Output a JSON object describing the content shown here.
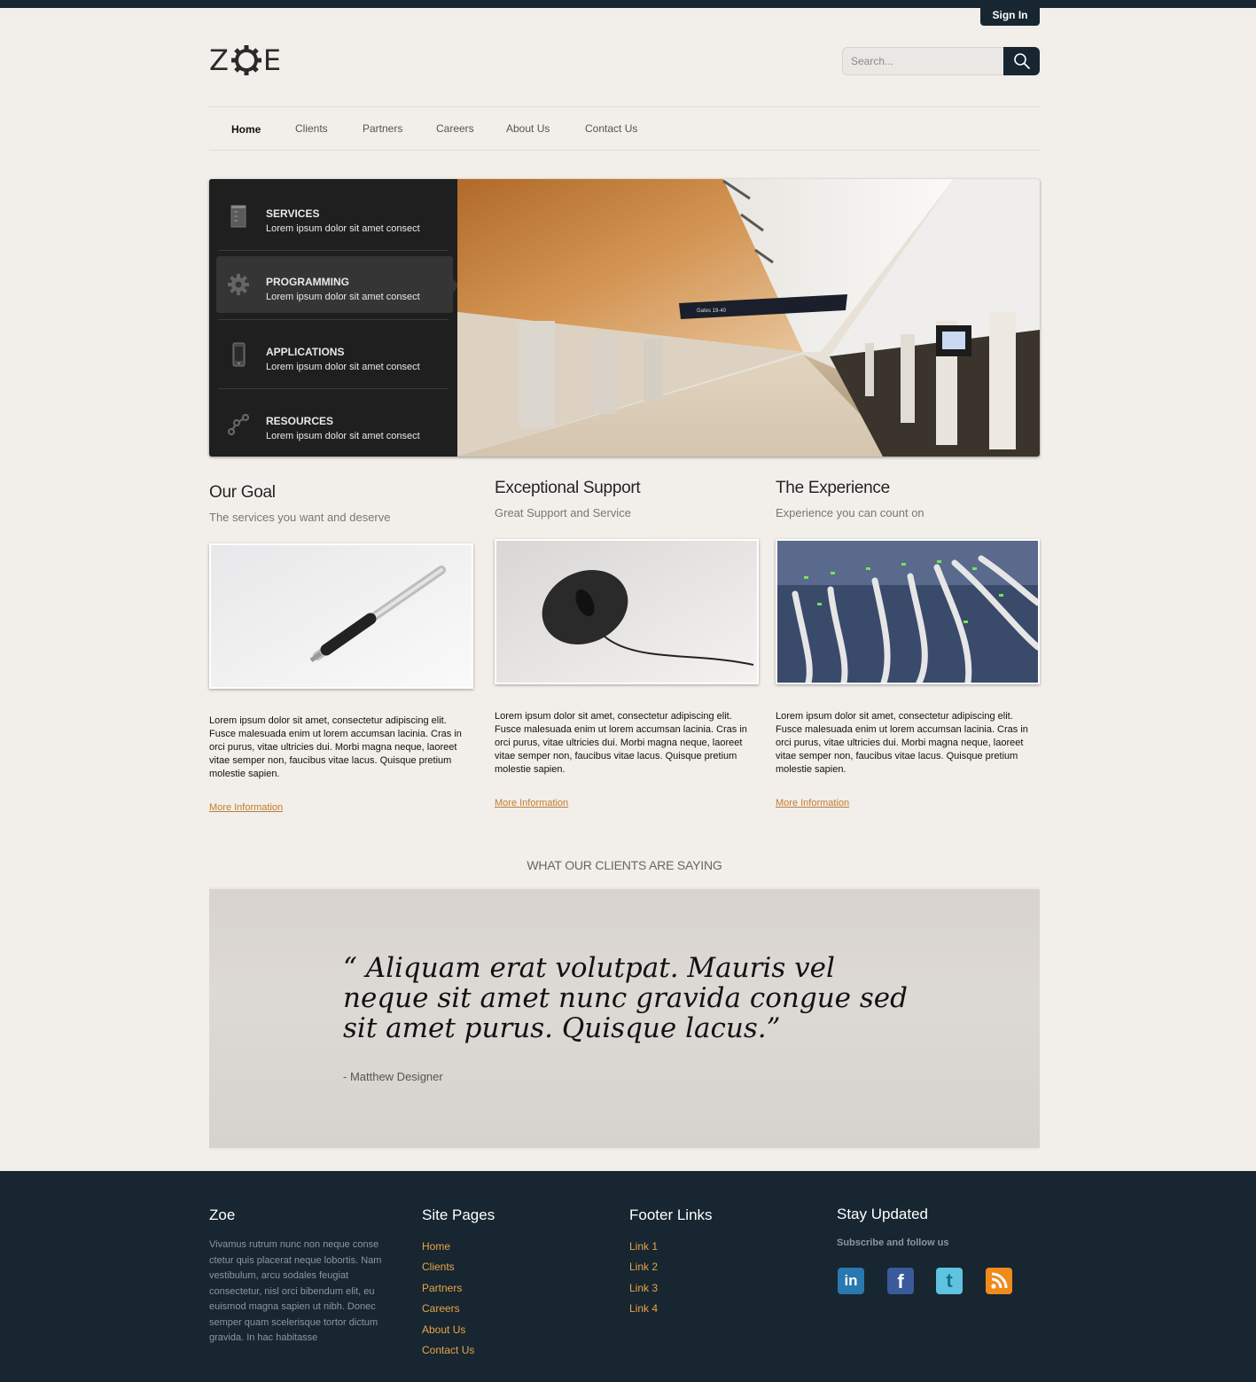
{
  "header": {
    "signin_label": "Sign In",
    "logo_text_left": "Z",
    "logo_text_right": "E",
    "search_placeholder": "Search..."
  },
  "nav": {
    "items": [
      {
        "label": "Home",
        "active": true
      },
      {
        "label": "Clients"
      },
      {
        "label": "Partners"
      },
      {
        "label": "Careers"
      },
      {
        "label": "About Us"
      },
      {
        "label": "Contact Us"
      }
    ]
  },
  "slider": {
    "items": [
      {
        "title": "SERVICES",
        "text": "Lorem ipsum dolor sit amet consect",
        "icon": "beaker-icon"
      },
      {
        "title": "PROGRAMMING",
        "text": "Lorem ipsum dolor sit amet consect",
        "icon": "gear-icon",
        "active": true
      },
      {
        "title": "APPLICATIONS",
        "text": "Lorem ipsum dolor sit amet consect",
        "icon": "phone-icon"
      },
      {
        "title": "RESOURCES",
        "text": "Lorem ipsum dolor sit amet consect",
        "icon": "nodes-icon"
      }
    ],
    "hero_sign": "Gates 19-40"
  },
  "features": [
    {
      "title": "Our Goal",
      "tagline": "The services you want and deserve",
      "image": "pen-photo",
      "text": "Lorem ipsum dolor sit amet, consectetur adipiscing elit. Fusce malesuada enim ut lorem accumsan lacinia. Cras in orci purus, vitae ultricies dui. Morbi magna neque, laoreet vitae semper non, faucibus vitae lacus. Quisque pretium molestie sapien.",
      "link": "More Information"
    },
    {
      "title": "Exceptional Support",
      "tagline": "Great Support and Service",
      "image": "mouse-photo",
      "text": "Lorem ipsum dolor sit amet, consectetur adipiscing elit. Fusce malesuada enim ut lorem accumsan lacinia. Cras in orci purus, vitae ultricies dui. Morbi magna neque, laoreet vitae semper non, faucibus vitae lacus. Quisque pretium molestie sapien.",
      "link": "More Information"
    },
    {
      "title": "The Experience",
      "tagline": "Experience you can count on",
      "image": "network-cables-photo",
      "text": "Lorem ipsum dolor sit amet, consectetur adipiscing elit. Fusce malesuada enim ut lorem accumsan lacinia. Cras in orci purus, vitae ultricies dui. Morbi magna neque, laoreet vitae semper non, faucibus vitae lacus. Quisque pretium molestie sapien.",
      "link": "More Information"
    }
  ],
  "testimonial": {
    "heading": "WHAT OUR CLIENTS ARE SAYING",
    "quote": "“ Aliquam erat volutpat. Mauris vel neque sit amet nunc gravida congue sed sit amet purus. Quisque lacus.”",
    "author": "- Matthew Designer"
  },
  "footer": {
    "about": {
      "title": "Zoe",
      "text": "Vivamus rutrum nunc non neque conse ctetur quis placerat neque lobortis. Nam vestibulum, arcu sodales feugiat consectetur, nisl orci bibendum elit, eu euismod magna sapien ut nibh. Donec semper quam scelerisque tortor dictum gravida. In hac habitasse"
    },
    "site_pages": {
      "title": "Site Pages",
      "links": [
        "Home",
        "Clients",
        "Partners",
        "Careers",
        "About Us",
        "Contact Us"
      ]
    },
    "footer_links": {
      "title": "Footer Links",
      "links": [
        "Link 1",
        "Link 2",
        "Link 3",
        "Link 4"
      ]
    },
    "stay_updated": {
      "title": "Stay Updated",
      "subtitle": "Subscribe and follow us",
      "social": [
        {
          "name": "linkedin-icon",
          "label": "in",
          "color": "#2a78b0"
        },
        {
          "name": "facebook-icon",
          "label": "f",
          "color": "#3a5a9b"
        },
        {
          "name": "twitter-icon",
          "label": "t",
          "color": "#5ec3e0"
        },
        {
          "name": "rss-icon",
          "label": "rss",
          "color": "#f08a1c"
        }
      ]
    }
  },
  "colors": {
    "dark": "#172630",
    "accent_link": "#c27c31",
    "footer_link": "#e8a449",
    "page_bg": "#f2eeea"
  }
}
